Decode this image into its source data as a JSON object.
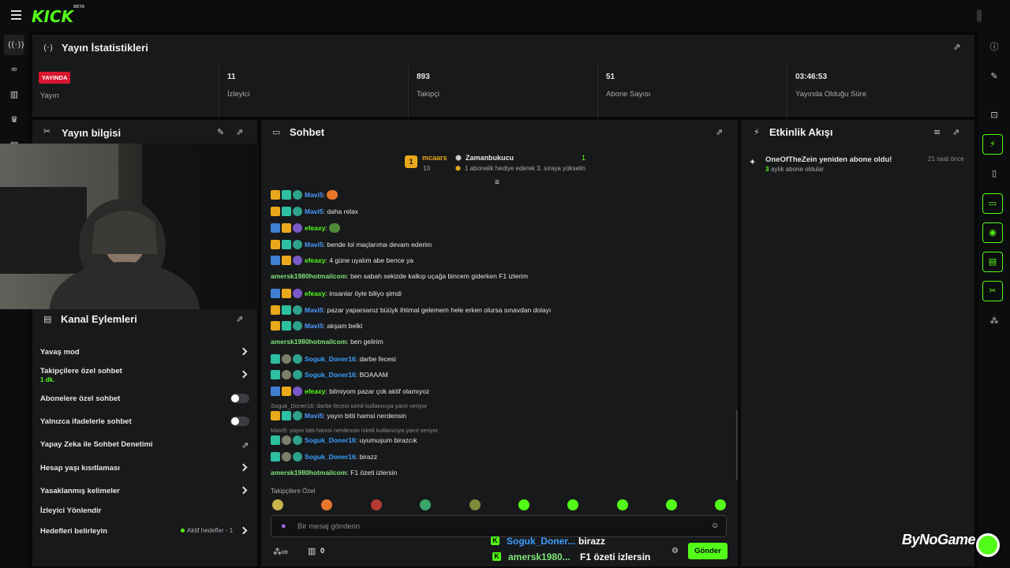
{
  "app": {
    "logo": "KICK",
    "logo_tag": "BETA"
  },
  "stats": {
    "title": "Yayın İstatistikleri",
    "live_badge": "YAYINDA",
    "items": [
      {
        "value": "",
        "label": "Yayın"
      },
      {
        "value": "11",
        "label": "İzleyici"
      },
      {
        "value": "893",
        "label": "Takipçi"
      },
      {
        "value": "51",
        "label": "Abone Sayısı"
      },
      {
        "value": "03:46:53",
        "label": "Yayında Olduğu Süre"
      }
    ]
  },
  "stream_info": {
    "title": "Yayın bilgisi"
  },
  "channel_actions": {
    "title": "Kanal Eylemleri",
    "items": [
      {
        "label": "Yavaş mod"
      },
      {
        "label": "Takipçilere özel sohbet",
        "sub": "1 dk."
      },
      {
        "label": "Abonelere özel sohbet"
      },
      {
        "label": "Yalnızca ifadelerle sohbet"
      },
      {
        "label": "Yapay Zeka ile Sohbet Denetimi"
      },
      {
        "label": "Hesap yaşı kısıtlaması"
      },
      {
        "label": "Yasaklanmış kelimeler"
      },
      {
        "label": "İzleyici Yönlendir"
      },
      {
        "label": "Hedefleri belirleyin",
        "extra": "Aktif hedefler - 1"
      }
    ]
  },
  "chat": {
    "title": "Sohbet",
    "pinned": {
      "rank": "1",
      "user": "mcaars",
      "user_count": "10",
      "gifter": "Zamanbukucu",
      "gift_count": "1",
      "desc": "1 abonelik hediye ederek 3. sıraya yükselin"
    },
    "messages": [
      {
        "user": "Mavi5",
        "text": "",
        "color": "#4b9bff"
      },
      {
        "user": "Mavi5",
        "text": "daha relax",
        "color": "#4b9bff"
      },
      {
        "user": "efeaxy",
        "text": "",
        "color": "#53fc18"
      },
      {
        "user": "Mavi5",
        "text": "bende lol maçlarıma devam ederim",
        "color": "#4b9bff"
      },
      {
        "user": "efeaxy",
        "text": "4 güne uyalım abe bence ya",
        "color": "#53fc18"
      },
      {
        "user": "amersk1980hotmailcom",
        "text": "ben sabah sekizde kalkıp uçağa bincem giderken F1 izlerim",
        "color": "#7ee47b"
      },
      {
        "user": "efeaxy",
        "text": "insanlar öyle biliyo şimdi",
        "color": "#53fc18"
      },
      {
        "user": "Mavi5",
        "text": "pazar yaparsanız büüyk ihtimal gelemem hele erken olursa sınavdan dolayı",
        "color": "#4b9bff"
      },
      {
        "user": "Mavi5",
        "text": "akşam belki",
        "color": "#4b9bff"
      },
      {
        "user": "amersk1980hotmailcom",
        "text": "ben gelirim",
        "color": "#7ee47b"
      },
      {
        "user": "Soguk_Doner16",
        "text": "darbe fecesi",
        "color": "#3aa0ff"
      },
      {
        "user": "Soguk_Doner16",
        "text": "BOAAAM",
        "color": "#3aa0ff"
      },
      {
        "user": "efeaxy",
        "text": "bilmiyom pazar çok aktif olamıyoz",
        "color": "#53fc18"
      },
      {
        "user": "Mavi5",
        "text": "yayın bitti hamsi nerdensin",
        "color": "#4b9bff"
      },
      {
        "user": "Soguk_Doner16",
        "text": "uyumuşum birazcık",
        "color": "#3aa0ff"
      },
      {
        "user": "Soguk_Doner16",
        "text": "birazz",
        "color": "#3aa0ff"
      },
      {
        "user": "amersk1980hotmailcom",
        "text": "F1 özeti izlersin",
        "color": "#7ee47b"
      }
    ],
    "replies": [
      "Soguk_Doner16: darbe fecesi isimli kullanıcıya yanıt veriyor",
      "Mavi5: yayın bitti hamsi nerdensin isimli kullanıcıya yanıt veriyor"
    ],
    "followers_only_label": "Takipçilere Özel",
    "input_placeholder": "Bir mesaj gönderin",
    "send_label": "Gönder",
    "points": "0"
  },
  "activity": {
    "title": "Etkinlik Akışı",
    "items": [
      {
        "text": "OneOfTheZein yeniden abone oldu!",
        "count": "3",
        "sub": "aylık abone oldular",
        "time": "21 saat önce"
      }
    ]
  },
  "overlay": {
    "lines": [
      {
        "user": "Soguk_Doner...",
        "text": "birazz"
      },
      {
        "user": "amersk1980...",
        "text": "F1 özeti izlersin"
      }
    ],
    "watermark": "ByNoGame"
  },
  "colors": {
    "accent": "#53fc18",
    "live": "#d9162f"
  }
}
